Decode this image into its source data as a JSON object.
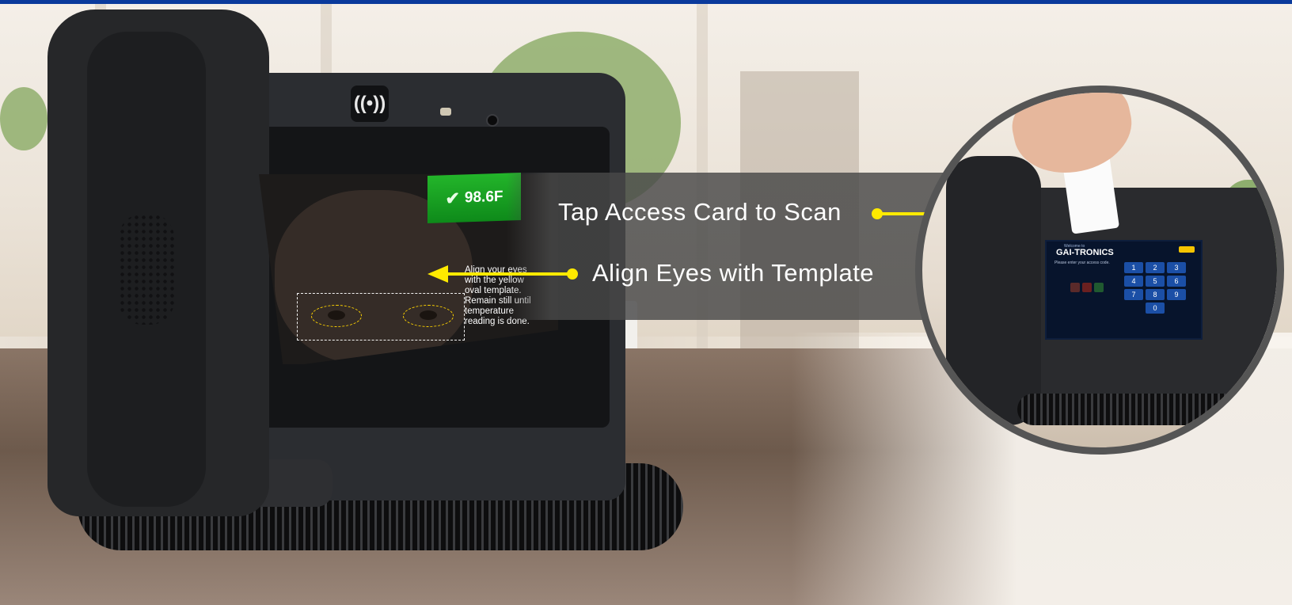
{
  "callouts": {
    "tap_card": "Tap Access Card to Scan",
    "align_eyes": "Align Eyes with Template"
  },
  "device_screen": {
    "temperature": "98.6F",
    "instructions_line1": "Align your eyes",
    "instructions_line2": "with the yellow",
    "instructions_line3": "oval template.",
    "instructions_line4": "Remain still until",
    "instructions_line5": "temperature",
    "instructions_line6": "reading is done."
  },
  "inset_screen": {
    "welcome": "Welcome to",
    "brand": "GAI-TRONICS",
    "prompt": "Please enter your access code.",
    "keys": [
      "1",
      "2",
      "3",
      "4",
      "5",
      "6",
      "7",
      "8",
      "9",
      "",
      "0",
      ""
    ]
  },
  "colors": {
    "top_bar": "#0a3a9c",
    "arrow": "#ffea00",
    "temp_badge": "#1aa024"
  },
  "icons": [
    "nfc-wireless-icon",
    "checkmark-icon"
  ]
}
